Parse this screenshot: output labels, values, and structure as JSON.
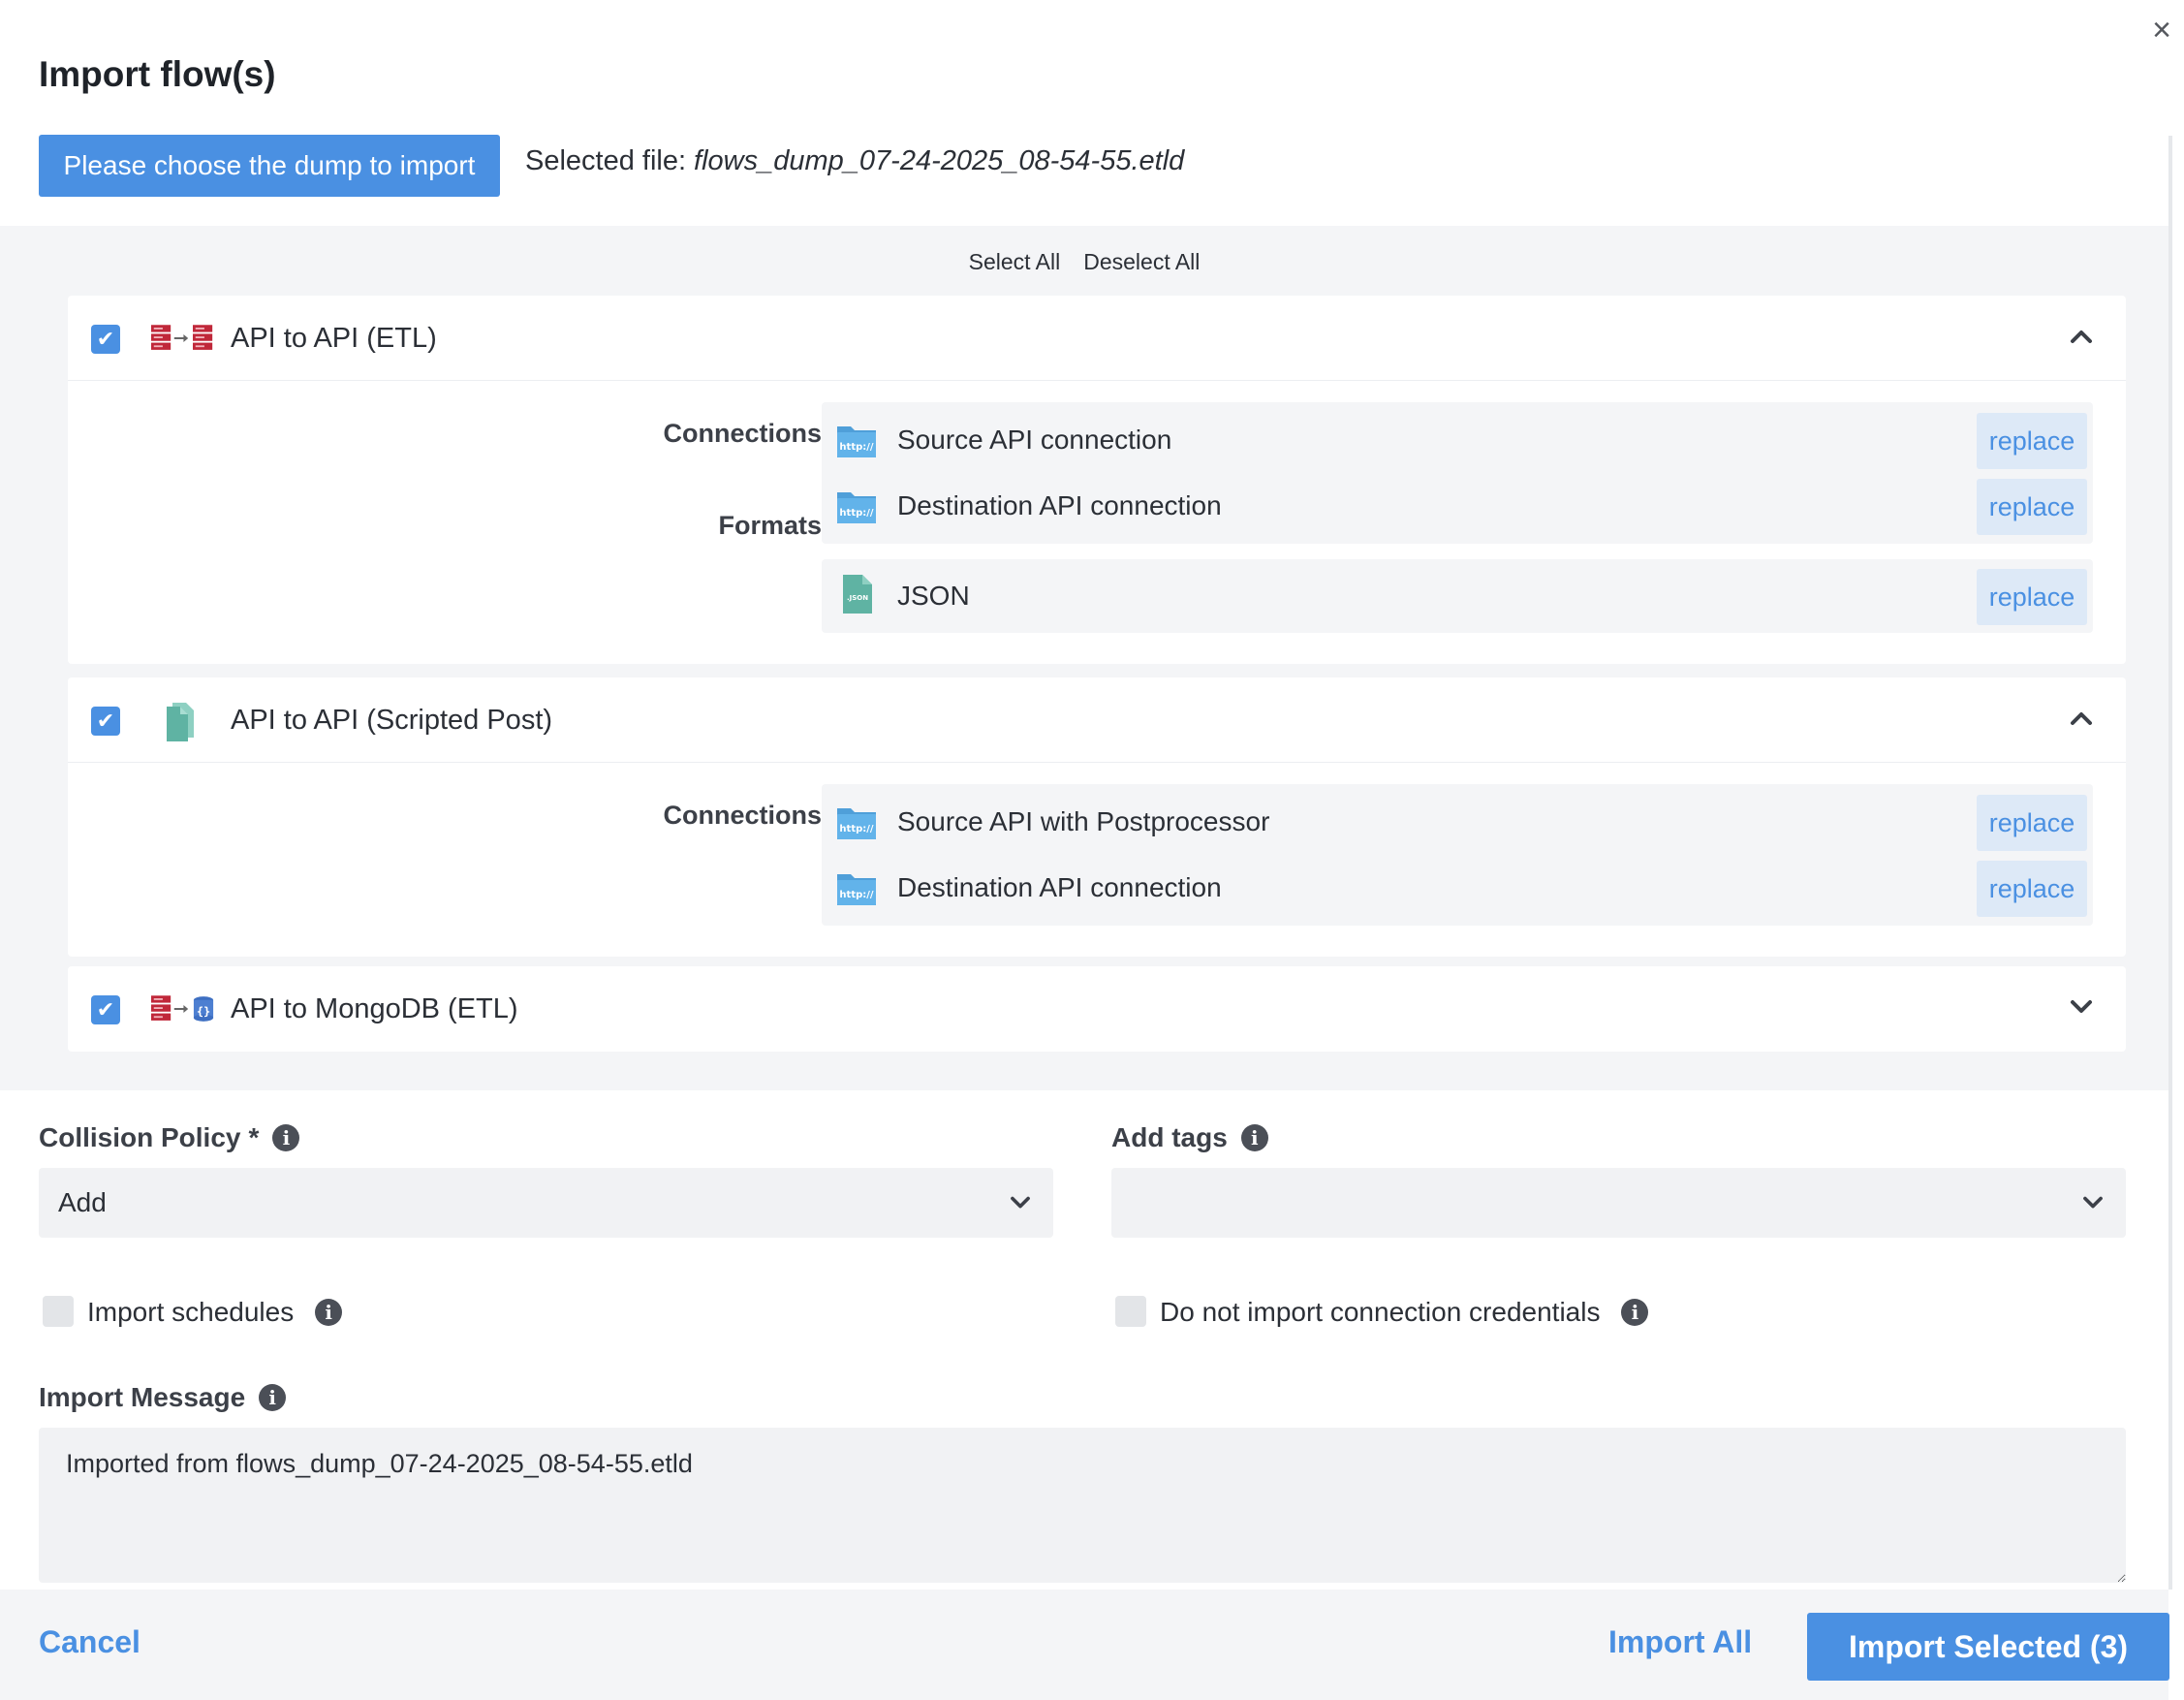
{
  "dialog": {
    "title": "Import flow(s)",
    "close_glyph": "×",
    "choose_button": "Please choose the dump to import",
    "selected_file_label": "Selected file:",
    "selected_file_name": "flows_dump_07-24-2025_08-54-55.etld",
    "select_all": "Select All",
    "deselect_all": "Deselect All"
  },
  "flows": [
    {
      "title": "API to API (ETL)",
      "checked": true,
      "expanded": true,
      "icon": "api-to-api-etl-icon",
      "sections": [
        {
          "label": "Connections",
          "items": [
            {
              "label": "Source API connection",
              "icon": "http-folder-icon",
              "action": "replace"
            },
            {
              "label": "Destination API connection",
              "icon": "http-folder-icon",
              "action": "replace"
            }
          ]
        },
        {
          "label": "Formats",
          "items": [
            {
              "label": "JSON",
              "icon": "json-file-icon",
              "action": "replace"
            }
          ]
        }
      ]
    },
    {
      "title": "API to API (Scripted Post)",
      "checked": true,
      "expanded": true,
      "icon": "scripted-post-icon",
      "sections": [
        {
          "label": "Connections",
          "items": [
            {
              "label": "Source API with Postprocessor",
              "icon": "http-folder-icon",
              "action": "replace"
            },
            {
              "label": "Destination API connection",
              "icon": "http-folder-icon",
              "action": "replace"
            }
          ]
        }
      ]
    },
    {
      "title": "API to MongoDB (ETL)",
      "checked": true,
      "expanded": false,
      "icon": "api-to-mongodb-icon"
    }
  ],
  "form": {
    "collision_policy_label": "Collision Policy",
    "required_mark": "*",
    "collision_policy_value": "Add",
    "add_tags_label": "Add tags",
    "add_tags_value": "",
    "import_schedules_label": "Import schedules",
    "import_schedules_checked": false,
    "no_credentials_label": "Do not import connection credentials",
    "no_credentials_checked": false,
    "import_message_label": "Import Message",
    "import_message_value": "Imported from flows_dump_07-24-2025_08-54-55.etld",
    "info_glyph": "i"
  },
  "footer": {
    "cancel": "Cancel",
    "import_all": "Import All",
    "import_selected": "Import Selected (3)"
  },
  "colors": {
    "accent": "#4a90e2",
    "replace_bg": "#dde9f7",
    "panel_bg": "#f4f5f7",
    "server_red": "#c0283a",
    "file_teal": "#5fb3a3",
    "folder_blue": "#5aace5"
  }
}
